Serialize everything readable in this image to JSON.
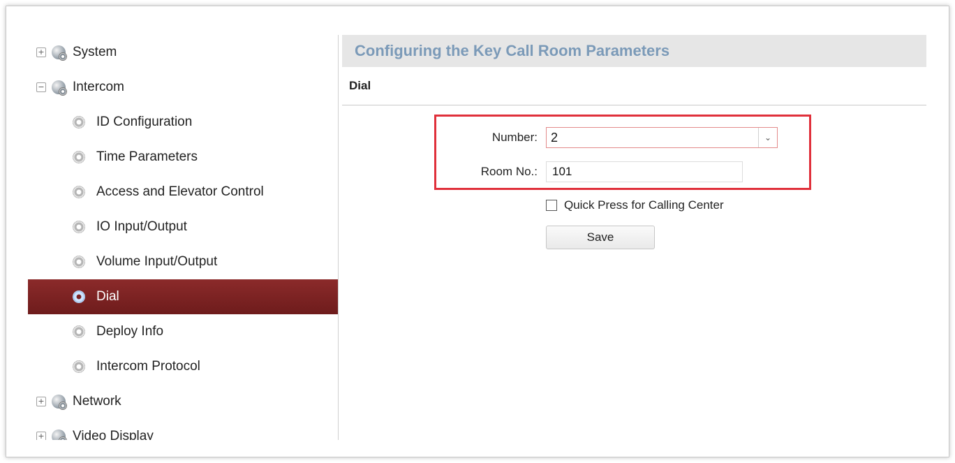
{
  "tree": {
    "system": {
      "label": "System",
      "toggle": "+"
    },
    "intercom": {
      "label": "Intercom",
      "toggle": "−",
      "children": [
        {
          "label": "ID Configuration"
        },
        {
          "label": "Time Parameters"
        },
        {
          "label": "Access and Elevator Control"
        },
        {
          "label": "IO Input/Output"
        },
        {
          "label": "Volume Input/Output"
        },
        {
          "label": "Dial",
          "active": true
        },
        {
          "label": "Deploy Info"
        },
        {
          "label": "Intercom Protocol"
        }
      ]
    },
    "network": {
      "label": "Network",
      "toggle": "+"
    },
    "video_display": {
      "label": "Video Display",
      "toggle": "+"
    }
  },
  "main": {
    "title": "Configuring the Key Call Room Parameters",
    "section": "Dial",
    "number": {
      "label": "Number:",
      "value": "2"
    },
    "room": {
      "label": "Room No.:",
      "value": "101"
    },
    "quick_press": {
      "label": "Quick Press for Calling Center",
      "checked": false
    },
    "save_label": "Save"
  },
  "colors": {
    "active_item": "#7a2222",
    "header_text": "#7b9ab8",
    "highlight_border": "#e0303b"
  }
}
